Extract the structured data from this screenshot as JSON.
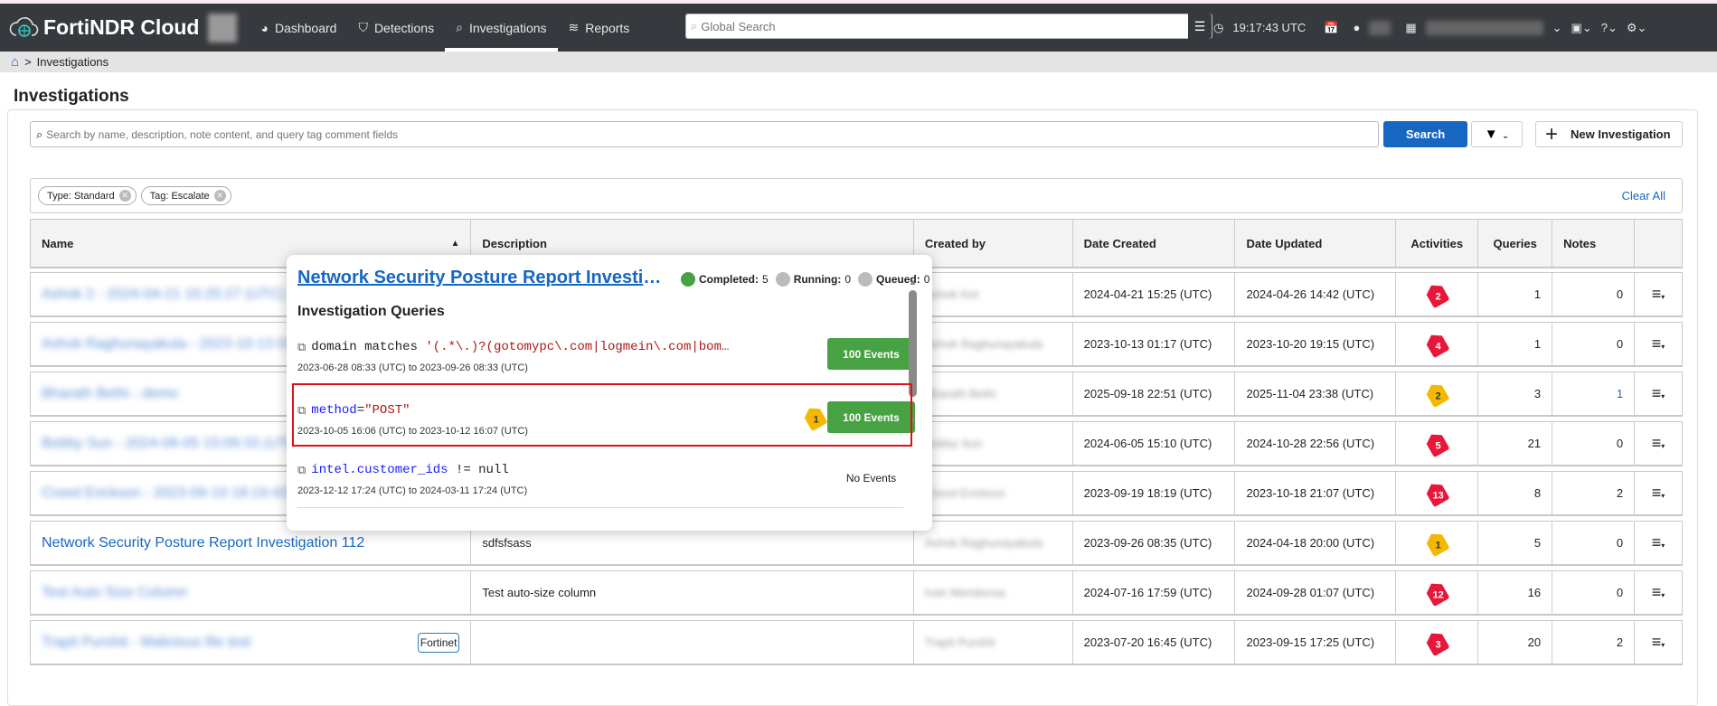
{
  "nav": {
    "brand": "FortiNDR Cloud",
    "items": [
      {
        "label": "Dashboard",
        "icon": "dashboard-icon"
      },
      {
        "label": "Detections",
        "icon": "shield-icon"
      },
      {
        "label": "Investigations",
        "icon": "search-icon",
        "active": true
      },
      {
        "label": "Reports",
        "icon": "layers-icon"
      }
    ],
    "global_search_placeholder": "Global Search",
    "clock": "19:17:43 UTC"
  },
  "breadcrumb": {
    "current": "Investigations"
  },
  "page": {
    "title": "Investigations",
    "search_placeholder": "Search by name, description, note content, and query tag comment fields",
    "search_button": "Search",
    "new_button": "New Investigation",
    "clear_all": "Clear All",
    "chips": [
      "Type: Standard",
      "Tag: Escalate"
    ]
  },
  "table": {
    "headers": [
      "Name",
      "Description",
      "Created by",
      "Date Created",
      "Date Updated",
      "Activities",
      "Queries",
      "Notes"
    ],
    "rows": [
      {
        "name": "Ashok 2 - 2024-04-21 15:25:27 (UTC)",
        "blurred": true,
        "description": "",
        "created_by": "Ashok Ket",
        "date_created": "2024-04-21 15:25 (UTC)",
        "date_updated": "2024-04-26 14:42 (UTC)",
        "activities": "2",
        "tag_color": "#e8173a",
        "queries": "1",
        "notes": "0"
      },
      {
        "name": "Ashok Raghunayakula - 2023-10-13 01:17",
        "blurred": true,
        "description": "",
        "created_by": "Ashok Raghunayakula",
        "date_created": "2023-10-13 01:17 (UTC)",
        "date_updated": "2023-10-20 19:15 (UTC)",
        "activities": "4",
        "tag_color": "#e8173a",
        "queries": "1",
        "notes": "0"
      },
      {
        "name": "Bharath Bethi - demo",
        "blurred": true,
        "description": "",
        "created_by": "Bharath Bethi",
        "date_created": "2025-09-18 22:51 (UTC)",
        "date_updated": "2025-11-04 23:38 (UTC)",
        "activities": "2",
        "tag_color": "#f5b800",
        "queries": "3",
        "notes": "1"
      },
      {
        "name": "Bobby Sun - 2024-06-05 15:09:33 (UTC)",
        "blurred": true,
        "description": "",
        "created_by": "Bobby Sun",
        "date_created": "2024-06-05 15:10 (UTC)",
        "date_updated": "2024-10-28 22:56 (UTC)",
        "activities": "5",
        "tag_color": "#e8173a",
        "queries": "21",
        "notes": "0"
      },
      {
        "name": "Creed Erickson - 2023-09-19 18:19:43",
        "blurred": true,
        "description": "",
        "created_by": "Creed Erickson",
        "date_created": "2023-09-19 18:19 (UTC)",
        "date_updated": "2023-10-18 21:07 (UTC)",
        "activities": "13",
        "tag_color": "#e8173a",
        "queries": "8",
        "notes": "2"
      },
      {
        "name": "Network Security Posture Report Investigation 112",
        "blurred": false,
        "description": "sdfsfsass",
        "created_by": "Ashok Raghunayakula",
        "date_created": "2023-09-26 08:35 (UTC)",
        "date_updated": "2024-04-18 20:00 (UTC)",
        "activities": "1",
        "tag_color": "#f5b800",
        "queries": "5",
        "notes": "0"
      },
      {
        "name": "Test Auto Size Column",
        "blurred": true,
        "description": "Test auto-size column",
        "created_by": "Ivan Mendonsa",
        "date_created": "2024-07-16 17:59 (UTC)",
        "date_updated": "2024-09-28 01:07 (UTC)",
        "activities": "12",
        "tag_color": "#e8173a",
        "queries": "16",
        "notes": "0"
      },
      {
        "name": "Trapti Purohit - Malicious file test",
        "blurred": true,
        "badge": "Fortinet",
        "description": "",
        "created_by": "Trapti Purohit",
        "date_created": "2023-07-20 16:45 (UTC)",
        "date_updated": "2023-09-15 17:25 (UTC)",
        "activities": "3",
        "tag_color": "#e8173a",
        "queries": "20",
        "notes": "2"
      }
    ]
  },
  "popover": {
    "title": "Network Security Posture Report Investiga...",
    "completed_label": "Completed:",
    "completed": "5",
    "running_label": "Running:",
    "running": "0",
    "queued_label": "Queued:",
    "queued": "0",
    "section": "Investigation Queries",
    "queries": [
      {
        "parts": [
          {
            "t": "domain matches ",
            "c": ""
          },
          {
            "t": "'(.*\\.)?(gotomypc\\.com|logmein\\.com|bom…",
            "c": "str"
          }
        ],
        "range": "2023-06-28 08:33 (UTC) to 2023-09-26 08:33 (UTC)",
        "events": "100 Events"
      },
      {
        "parts": [
          {
            "t": "method",
            "c": "kw"
          },
          {
            "t": "=",
            "c": ""
          },
          {
            "t": "\"POST\"",
            "c": "str"
          }
        ],
        "range": "2023-10-05 16:06 (UTC) to 2023-10-12 16:07 (UTC)",
        "events": "100 Events",
        "tag": "1"
      },
      {
        "parts": [
          {
            "t": "intel.customer_ids",
            "c": "kw"
          },
          {
            "t": " != null",
            "c": ""
          }
        ],
        "range": "2023-12-12 17:24 (UTC) to 2024-03-11 17:24 (UTC)",
        "events": "No Events"
      }
    ]
  },
  "colors": {
    "accent": "#1767c2",
    "success": "#46a243",
    "danger": "#e8173a",
    "warning": "#f5b800",
    "nav": "#36393d"
  }
}
